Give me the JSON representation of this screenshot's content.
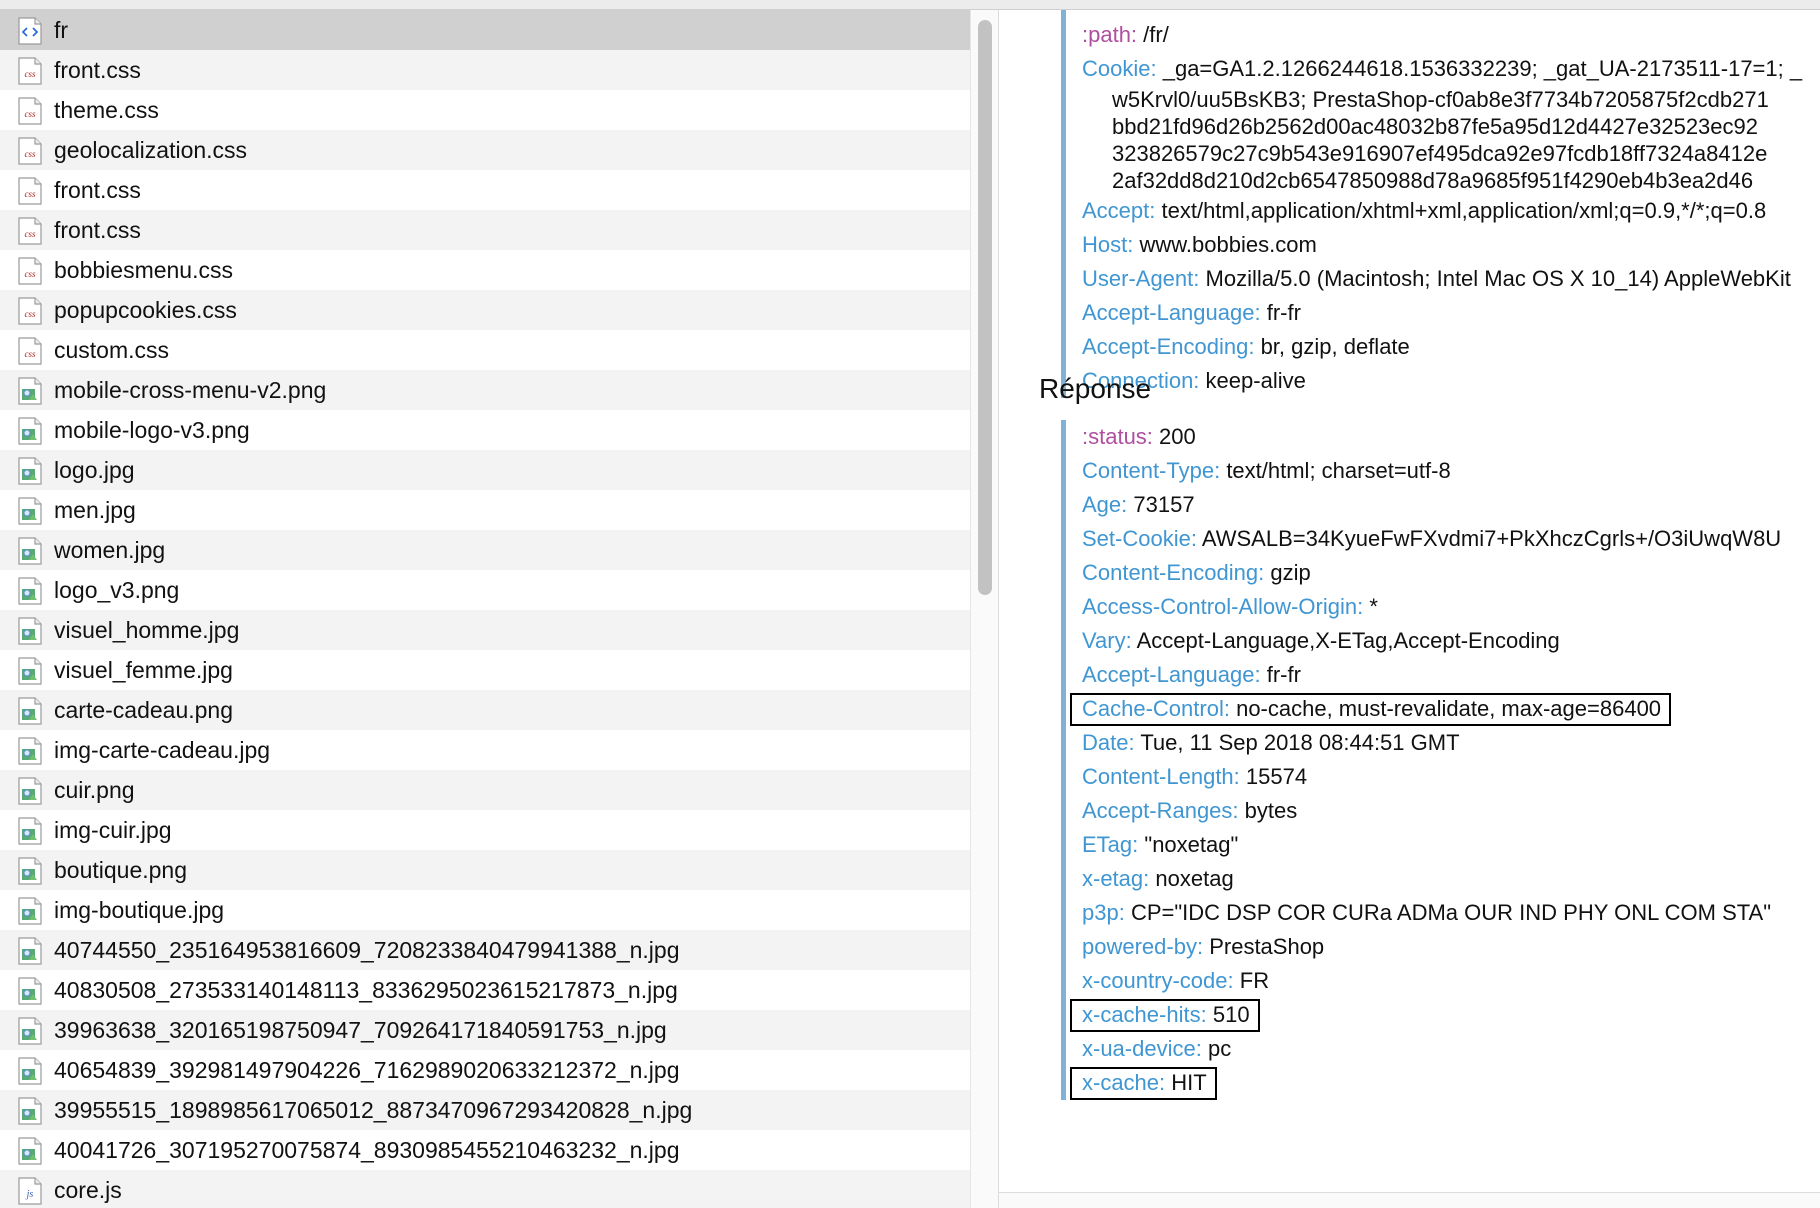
{
  "files": [
    {
      "name": "fr",
      "icon": "html-doc-icon",
      "selected": true
    },
    {
      "name": "front.css",
      "icon": "css-file-icon"
    },
    {
      "name": "theme.css",
      "icon": "css-file-icon"
    },
    {
      "name": "geolocalization.css",
      "icon": "css-file-icon"
    },
    {
      "name": "front.css",
      "icon": "css-file-icon"
    },
    {
      "name": "front.css",
      "icon": "css-file-icon"
    },
    {
      "name": "bobbiesmenu.css",
      "icon": "css-file-icon"
    },
    {
      "name": "popupcookies.css",
      "icon": "css-file-icon"
    },
    {
      "name": "custom.css",
      "icon": "css-file-icon"
    },
    {
      "name": "mobile-cross-menu-v2.png",
      "icon": "image-file-icon"
    },
    {
      "name": "mobile-logo-v3.png",
      "icon": "image-file-icon"
    },
    {
      "name": "logo.jpg",
      "icon": "image-file-icon"
    },
    {
      "name": "men.jpg",
      "icon": "image-file-icon"
    },
    {
      "name": "women.jpg",
      "icon": "image-file-icon"
    },
    {
      "name": "logo_v3.png",
      "icon": "image-file-icon"
    },
    {
      "name": "visuel_homme.jpg",
      "icon": "image-file-icon"
    },
    {
      "name": "visuel_femme.jpg",
      "icon": "image-file-icon"
    },
    {
      "name": "carte-cadeau.png",
      "icon": "image-file-icon"
    },
    {
      "name": "img-carte-cadeau.jpg",
      "icon": "image-file-icon"
    },
    {
      "name": "cuir.png",
      "icon": "image-file-icon"
    },
    {
      "name": "img-cuir.jpg",
      "icon": "image-file-icon"
    },
    {
      "name": "boutique.png",
      "icon": "image-file-icon"
    },
    {
      "name": "img-boutique.jpg",
      "icon": "image-file-icon"
    },
    {
      "name": "40744550_235164953816609_7208233840479941388_n.jpg",
      "icon": "image-file-icon"
    },
    {
      "name": "40830508_273533140148113_8336295023615217873_n.jpg",
      "icon": "image-file-icon"
    },
    {
      "name": "39963638_320165198750947_709264171840591753_n.jpg",
      "icon": "image-file-icon"
    },
    {
      "name": "40654839_392981497904226_7162989020633212372_n.jpg",
      "icon": "image-file-icon"
    },
    {
      "name": "39955515_1898985617065012_8873470967293420828_n.jpg",
      "icon": "image-file-icon"
    },
    {
      "name": "40041726_307195270075874_8930985455210463232_n.jpg",
      "icon": "image-file-icon"
    },
    {
      "name": "core.js",
      "icon": "js-file-icon"
    }
  ],
  "request": {
    "path": {
      "key": ":path:",
      "value": "/fr/"
    },
    "cookie": {
      "key": "Cookie:",
      "value": "_ga=GA1.2.1266244618.1536332239; _gat_UA-2173511-17=1; _",
      "continuation": [
        "w5Krvl0/uu5BsKB3; PrestaShop-cf0ab8e3f7734b7205875f2cdb271",
        "bbd21fd96d26b2562d00ac48032b87fe5a95d12d4427e32523ec92",
        "323826579c27c9b543e916907ef495dca92e97fcdb18ff7324a8412e",
        "2af32dd8d210d2cb6547850988d78a9685f951f4290eb4b3ea2d46"
      ]
    },
    "headers": [
      {
        "key": "Accept:",
        "value": "text/html,application/xhtml+xml,application/xml;q=0.9,*/*;q=0.8"
      },
      {
        "key": "Host:",
        "value": "www.bobbies.com"
      },
      {
        "key": "User-Agent:",
        "value": "Mozilla/5.0 (Macintosh; Intel Mac OS X 10_14) AppleWebKit"
      },
      {
        "key": "Accept-Language:",
        "value": "fr-fr"
      },
      {
        "key": "Accept-Encoding:",
        "value": "br, gzip, deflate"
      },
      {
        "key": "Connection:",
        "value": "keep-alive"
      }
    ]
  },
  "response": {
    "title": "Réponse",
    "headers": [
      {
        "key": ":status:",
        "value": "200",
        "pseudo": true
      },
      {
        "key": "Content-Type:",
        "value": "text/html; charset=utf-8"
      },
      {
        "key": "Age:",
        "value": "73157"
      },
      {
        "key": "Set-Cookie:",
        "value": "AWSALB=34KyueFwFXvdmi7+PkXhczCgrls+/O3iUwqW8U"
      },
      {
        "key": "Content-Encoding:",
        "value": "gzip"
      },
      {
        "key": "Access-Control-Allow-Origin:",
        "value": "*"
      },
      {
        "key": "Vary:",
        "value": "Accept-Language,X-ETag,Accept-Encoding"
      },
      {
        "key": "Accept-Language:",
        "value": "fr-fr"
      },
      {
        "key": "Cache-Control:",
        "value": "no-cache, must-revalidate, max-age=86400",
        "boxed": true
      },
      {
        "key": "Date:",
        "value": "Tue, 11 Sep 2018 08:44:51 GMT"
      },
      {
        "key": "Content-Length:",
        "value": "15574"
      },
      {
        "key": "Accept-Ranges:",
        "value": "bytes"
      },
      {
        "key": "ETag:",
        "value": "\"noxetag\""
      },
      {
        "key": "x-etag:",
        "value": "noxetag"
      },
      {
        "key": "p3p:",
        "value": "CP=\"IDC DSP COR CURa ADMa OUR IND PHY ONL COM STA\""
      },
      {
        "key": "powered-by:",
        "value": "PrestaShop"
      },
      {
        "key": "x-country-code:",
        "value": "FR"
      },
      {
        "key": "x-cache-hits:",
        "value": "510",
        "boxed": true
      },
      {
        "key": "x-ua-device:",
        "value": "pc"
      },
      {
        "key": "x-cache:",
        "value": "HIT",
        "boxed": true
      }
    ]
  },
  "colors": {
    "header_key": "#3f96d2",
    "pseudo_key": "#b04ea0",
    "block_rule": "#7fb2d6",
    "row_alt": "#f3f3f3",
    "row_selected": "#d0d0d0"
  }
}
